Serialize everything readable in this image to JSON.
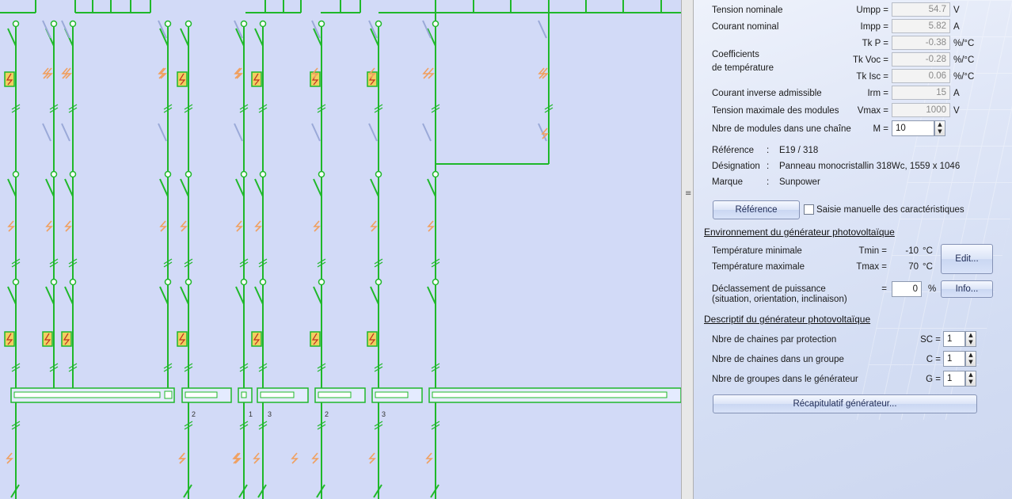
{
  "panel": {
    "rows": [
      {
        "label": "Tension nominale",
        "symbol": "Umpp =",
        "value": "54.7",
        "unit": "V"
      },
      {
        "label": "Courant nominal",
        "symbol": "Impp =",
        "value": "5.82",
        "unit": "A"
      },
      {
        "label": "",
        "symbol": "Tk P =",
        "value": "-0.38",
        "unit": "%/°C"
      },
      {
        "label": "",
        "symbol": "Tk Voc =",
        "value": "-0.28",
        "unit": "%/°C"
      },
      {
        "label": "",
        "symbol": "Tk Isc =",
        "value": "0.06",
        "unit": "%/°C"
      },
      {
        "label": "Courant inverse admissible",
        "symbol": "Irm =",
        "value": "15",
        "unit": "A"
      },
      {
        "label": "Tension maximale des modules",
        "symbol": "Vmax =",
        "value": "1000",
        "unit": "V"
      }
    ],
    "coef_label_1": "Coefficients",
    "coef_label_2": "de température",
    "modules_label": "Nbre de modules dans une chaîne",
    "modules_symbol": "M =",
    "modules_value": "10",
    "ref_label": "Référence",
    "ref_value": "E19 / 318",
    "designation_label": "Désignation",
    "designation_value": "Panneau monocristallin 318Wc, 1559 x 1046",
    "marque_label": "Marque",
    "marque_value": "Sunpower",
    "colon": ":",
    "reference_button": "Référence",
    "manual_checkbox_label": "Saisie manuelle des caractéristiques",
    "env_section": "Environnement du générateur photovoltaïque",
    "tmin_label": "Température minimale",
    "tmin_symbol": "Tmin =",
    "tmin_value": "-10",
    "tmax_label": "Température maximale",
    "tmax_symbol": "Tmax =",
    "tmax_value": "70",
    "deg_unit": "°C",
    "edit_button": "Edit...",
    "derating_label_1": "Déclassement de puissance",
    "derating_label_2": "(situation, orientation, inclinaison)",
    "derating_symbol": "=",
    "derating_value": "0",
    "derating_unit": "%",
    "info_button": "Info...",
    "desc_section": "Descriptif du générateur photovoltaïque",
    "sc_label": "Nbre de chaines par protection",
    "sc_symbol": "SC =",
    "sc_value": "1",
    "c_label": "Nbre de chaines dans un groupe",
    "c_symbol": "C =",
    "c_value": "1",
    "g_label": "Nbre de groupes dans le générateur",
    "g_symbol": "G =",
    "g_value": "1",
    "summary_button": "Récapitulatif générateur..."
  },
  "schematic": {
    "bus_numbers": [
      "2",
      "1",
      "3",
      "2",
      "3"
    ]
  },
  "colors": {
    "wire": "#1fb82a",
    "fuse_fill": "#f0d060",
    "surge_mark": "#f0a060",
    "background": "#d2daf7"
  }
}
